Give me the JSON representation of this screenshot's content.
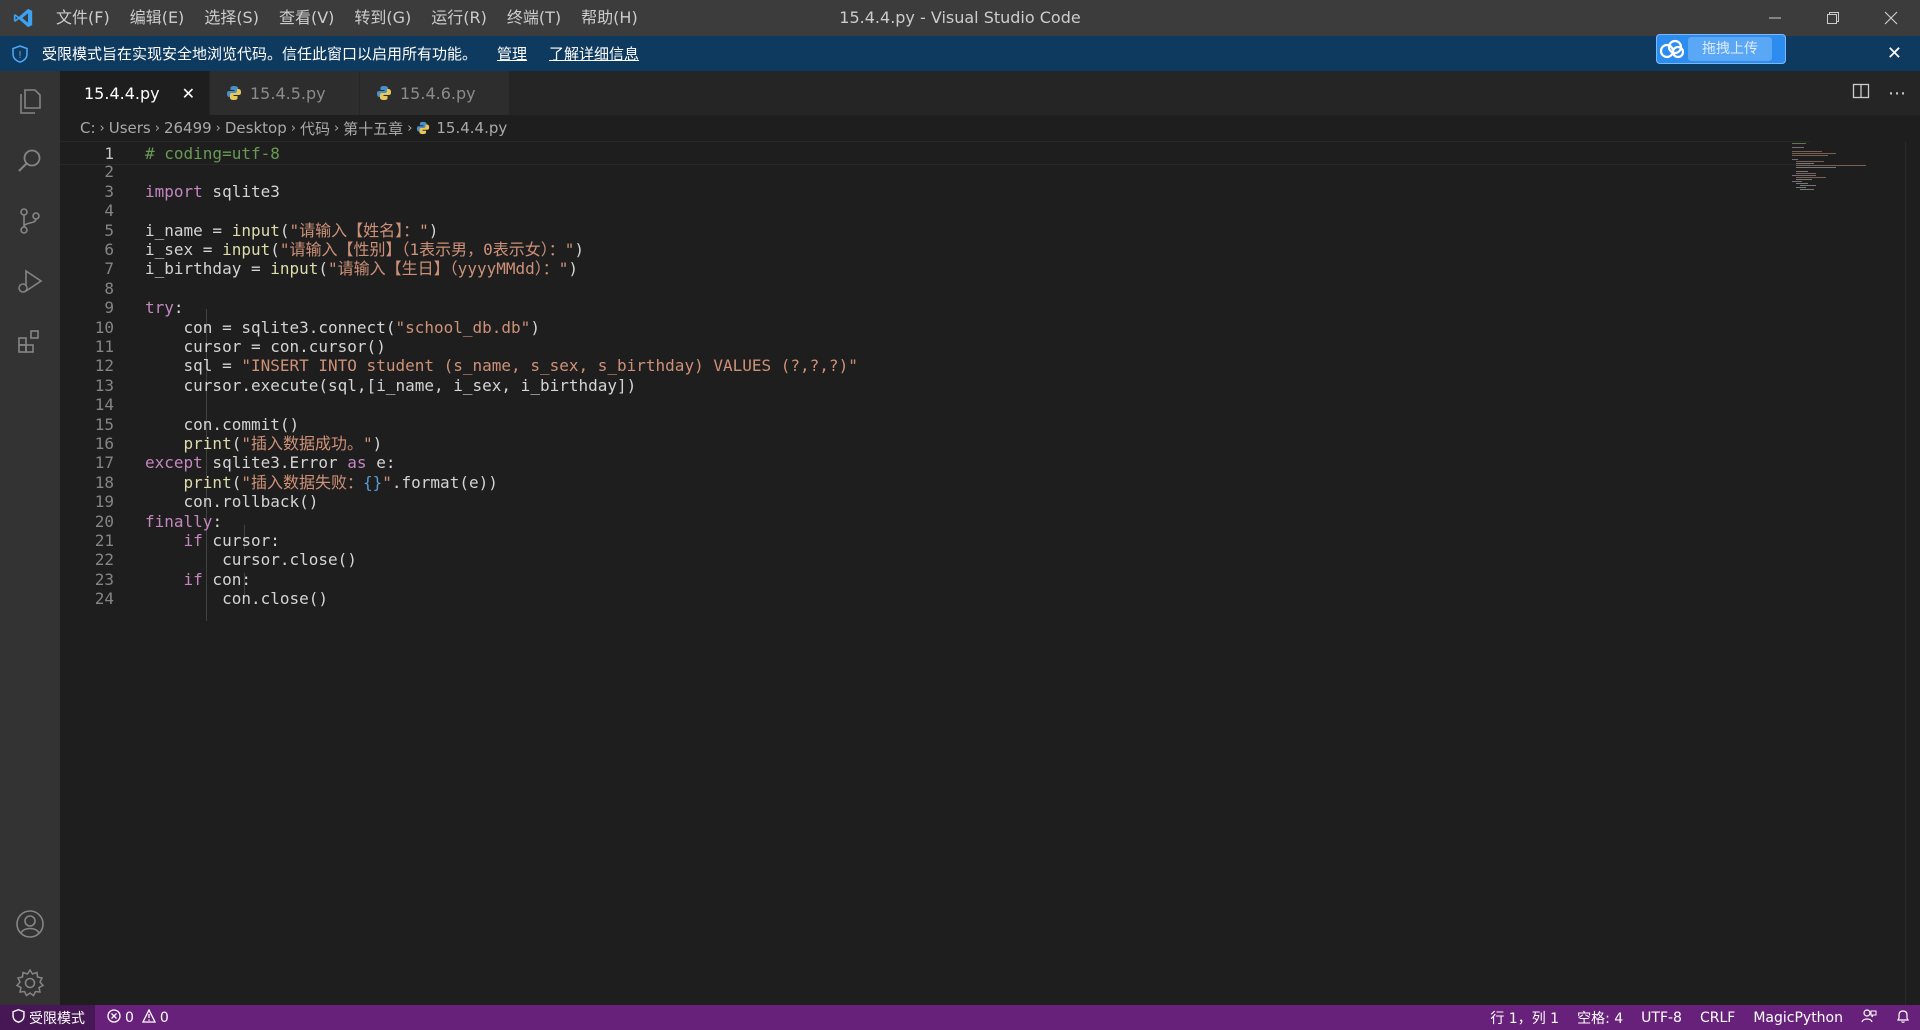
{
  "titlebar": {
    "menu": [
      "文件(F)",
      "编辑(E)",
      "选择(S)",
      "查看(V)",
      "转到(G)",
      "运行(R)",
      "终端(T)",
      "帮助(H)"
    ],
    "title": "15.4.4.py - Visual Studio Code"
  },
  "banner": {
    "message": "受限模式旨在实现安全地浏览代码。信任此窗口以启用所有功能。",
    "manage": "管理",
    "learn_more": "了解详细信息",
    "upload": "拖拽上传"
  },
  "activity_bar": [
    "explorer-icon",
    "search-icon",
    "source-control-icon",
    "run-debug-icon",
    "extensions-icon",
    "account-icon",
    "settings-gear-icon"
  ],
  "tabs": [
    {
      "label": "15.4.4.py",
      "active": true
    },
    {
      "label": "15.4.5.py",
      "active": false
    },
    {
      "label": "15.4.6.py",
      "active": false
    }
  ],
  "breadcrumb": [
    "C:",
    "Users",
    "26499",
    "Desktop",
    "代码",
    "第十五章",
    "15.4.4.py"
  ],
  "editor": {
    "current_line": 1,
    "lines": [
      [
        [
          "com",
          "# coding=utf-8"
        ]
      ],
      [],
      [
        [
          "kw",
          "import"
        ],
        [
          "txt",
          " sqlite3"
        ]
      ],
      [],
      [
        [
          "txt",
          "i_name = "
        ],
        [
          "bi",
          "input"
        ],
        [
          "txt",
          "("
        ],
        [
          "str",
          "\"请输入【姓名】：\""
        ],
        [
          "txt",
          ")"
        ]
      ],
      [
        [
          "txt",
          "i_sex = "
        ],
        [
          "bi",
          "input"
        ],
        [
          "txt",
          "("
        ],
        [
          "str",
          "\"请输入【性别】（1表示男，0表示女）：\""
        ],
        [
          "txt",
          ")"
        ]
      ],
      [
        [
          "txt",
          "i_birthday = "
        ],
        [
          "bi",
          "input"
        ],
        [
          "txt",
          "("
        ],
        [
          "str",
          "\"请输入【生日】（yyyyMMdd）：\""
        ],
        [
          "txt",
          ")"
        ]
      ],
      [],
      [
        [
          "kw",
          "try"
        ],
        [
          "txt",
          ":"
        ]
      ],
      [
        [
          "txt",
          "    con = sqlite3.connect("
        ],
        [
          "str",
          "\"school_db.db\""
        ],
        [
          "txt",
          ")"
        ]
      ],
      [
        [
          "txt",
          "    cursor = con.cursor()"
        ]
      ],
      [
        [
          "txt",
          "    sql = "
        ],
        [
          "str",
          "\"INSERT INTO student (s_name, s_sex, s_birthday) VALUES (?,?,?)\""
        ]
      ],
      [
        [
          "txt",
          "    cursor.execute(sql,[i_name, i_sex, i_birthday])"
        ]
      ],
      [],
      [
        [
          "txt",
          "    con.commit()"
        ]
      ],
      [
        [
          "txt",
          "    "
        ],
        [
          "bi",
          "print"
        ],
        [
          "txt",
          "("
        ],
        [
          "str",
          "\"插入数据成功。\""
        ],
        [
          "txt",
          ")"
        ]
      ],
      [
        [
          "kw",
          "except"
        ],
        [
          "txt",
          " sqlite3.Error "
        ],
        [
          "kw",
          "as"
        ],
        [
          "txt",
          " e:"
        ]
      ],
      [
        [
          "txt",
          "    "
        ],
        [
          "bi",
          "print"
        ],
        [
          "txt",
          "("
        ],
        [
          "str",
          "\"插入数据失败："
        ],
        [
          "esc",
          "{}"
        ],
        [
          "str",
          "\""
        ],
        [
          "txt",
          ".format(e))"
        ]
      ],
      [
        [
          "txt",
          "    con.rollback()"
        ]
      ],
      [
        [
          "kw",
          "finally"
        ],
        [
          "txt",
          ":"
        ]
      ],
      [
        [
          "txt",
          "    "
        ],
        [
          "kw",
          "if"
        ],
        [
          "txt",
          " cursor:"
        ]
      ],
      [
        [
          "txt",
          "        cursor.close()"
        ]
      ],
      [
        [
          "txt",
          "    "
        ],
        [
          "kw",
          "if"
        ],
        [
          "txt",
          " con:"
        ]
      ],
      [
        [
          "txt",
          "        con.close()"
        ]
      ]
    ]
  },
  "statusbar": {
    "restricted": "受限模式",
    "errors": "0",
    "warnings": "0",
    "position": "行 1，列 1",
    "spaces": "空格: 4",
    "encoding": "UTF-8",
    "eol": "CRLF",
    "language": "MagicPython"
  },
  "colors": {
    "statusbar": "#68217a",
    "banner": "#0e3a5f",
    "titlebar": "#3c3c3c",
    "activitybar": "#333333",
    "editor_bg": "#1e1e1e",
    "keyword": "#c586c0",
    "builtin": "#dcdcaa",
    "string": "#ce9178",
    "comment": "#6a9955"
  }
}
